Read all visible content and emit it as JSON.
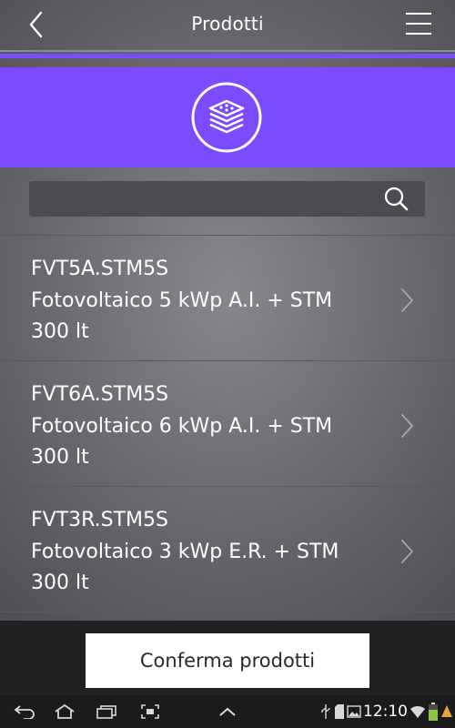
{
  "header": {
    "title": "Prodotti",
    "back_icon": "chevron-left-icon",
    "menu_icon": "hamburger-menu-icon"
  },
  "colors": {
    "accent_purple": "#7a4bff",
    "text_white": "#ffffff",
    "confirm_button_bg": "#ffffff"
  },
  "category": {
    "icon": "layered-stack-icon"
  },
  "search": {
    "value": "",
    "icon": "search-icon"
  },
  "products": [
    {
      "code": "FVT5A.STM5S",
      "description_line1": "Fotovoltaico 5 kWp A.I. + STM",
      "description_line2": "300 lt"
    },
    {
      "code": "FVT6A.STM5S",
      "description_line1": "Fotovoltaico 6 kWp A.I. + STM",
      "description_line2": "300 lt"
    },
    {
      "code": "FVT3R.STM5S",
      "description_line1": "Fotovoltaico 3 kWp E.R. + STM",
      "description_line2": "300 lt"
    }
  ],
  "footer": {
    "confirm_label": "Conferma prodotti"
  },
  "system_bar": {
    "time": "12:10"
  }
}
